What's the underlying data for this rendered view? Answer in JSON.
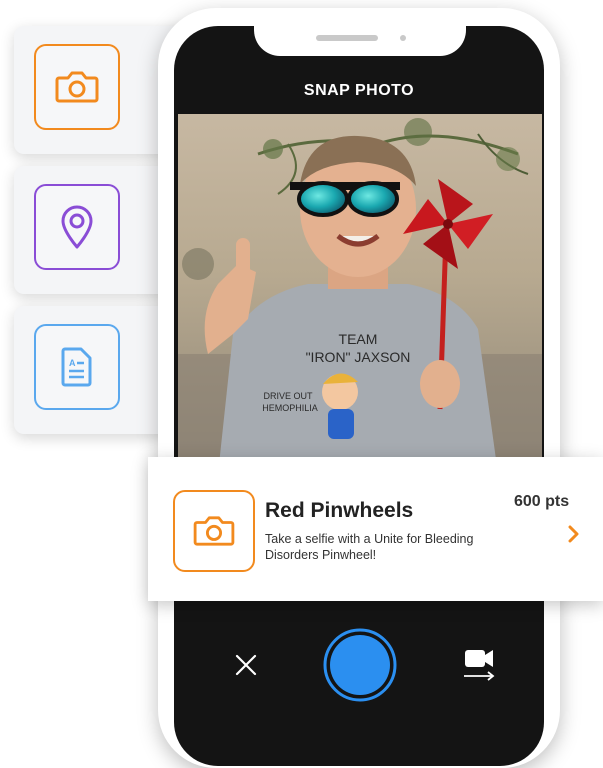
{
  "side_cards": [
    {
      "icon": "camera-icon",
      "color": "#f28a1e"
    },
    {
      "icon": "map-pin-icon",
      "color": "#8a4dd6"
    },
    {
      "icon": "document-icon",
      "color": "#5aa8ee"
    }
  ],
  "screen": {
    "title": "SNAP PHOTO",
    "photo_shirt_line1": "TEAM",
    "photo_shirt_line2": "\"IRON\" JAXSON",
    "photo_shirt_line3": "DRIVE OUT",
    "photo_shirt_line4": "HEMOPHILIA"
  },
  "challenge": {
    "icon": "camera-icon",
    "title": "Red Pinwheels",
    "description": "Take a selfie with a Unite for Bleeding Disorders Pinwheel!",
    "points": "600 pts",
    "accent_color": "#f28a1e"
  },
  "controls": {
    "close_icon": "close-icon",
    "shutter_color": "#2b8ff0",
    "video_icon": "video-switch-icon"
  }
}
